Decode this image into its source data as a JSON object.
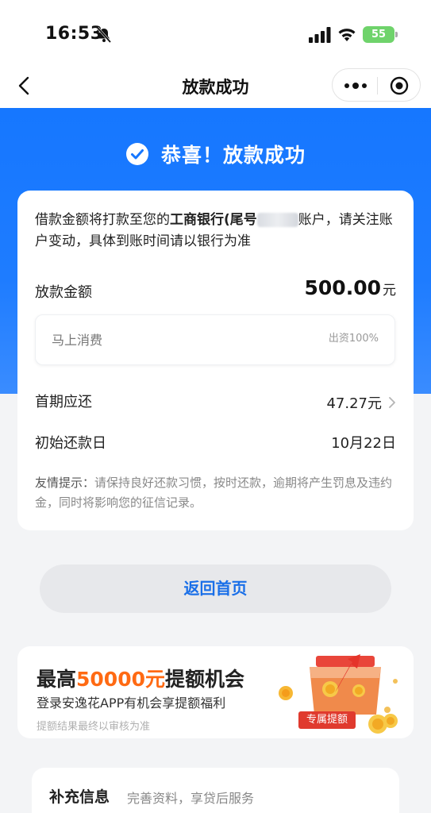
{
  "status_bar": {
    "time": "16:53",
    "battery": "55"
  },
  "nav": {
    "title": "放款成功"
  },
  "header": {
    "success_text": "恭喜！放款成功"
  },
  "notice": {
    "part1": "借款金额将打款至您的",
    "bank": "工商银行(尾号",
    "part2": "账户，请关注账户变动，具体到账时间请以银行为准"
  },
  "loan": {
    "amount_label": "放款金额",
    "amount_value": "500.00",
    "amount_unit": "元",
    "funder_name": "马上消费",
    "funder_ratio": "出资100%",
    "first_payment_label": "首期应还",
    "first_payment_value": "47.27元",
    "start_date_label": "初始还款日",
    "start_date_value": "10月22日"
  },
  "tip": {
    "label": "友情提示：",
    "text": "请保持良好还款习惯，按时还款，逾期将产生罚息及违约金，同时将影响您的征信记录。"
  },
  "home_button": "返回首页",
  "promo": {
    "title_pre": "最高",
    "title_highlight": "50000元",
    "title_post": "提额机会",
    "subtitle": "登录安逸花APP有机会享提额福利",
    "note": "提额结果最终以审核为准",
    "badge": "专属提额"
  },
  "extra": {
    "title": "补充信息",
    "subtitle": "完善资料，享贷后服务"
  },
  "colors": {
    "primary": "#1677ff",
    "accent": "#ff6a13",
    "battery": "#6fd36b"
  }
}
